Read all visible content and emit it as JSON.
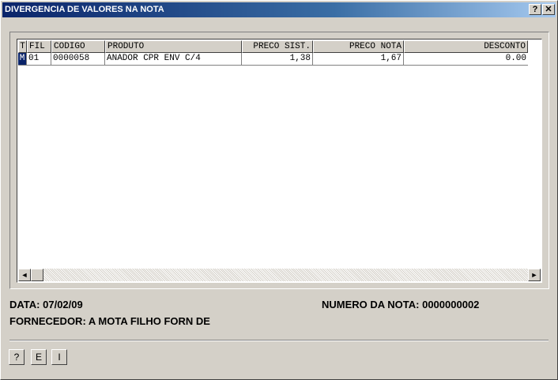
{
  "window": {
    "title": "DIVERGENCIA DE VALORES NA NOTA",
    "help_btn": "?",
    "close_btn": "✕"
  },
  "grid": {
    "columns": [
      "T",
      "FIL",
      "CODIGO",
      "PRODUTO",
      "PRECO SIST.",
      "PRECO NOTA",
      "DESCONTO"
    ],
    "rows": [
      {
        "t": "M",
        "fil": "01",
        "codigo": "0000058",
        "produto": "ANADOR CPR ENV C/4",
        "preco_sist": "1,38",
        "preco_nota": "1,67",
        "desconto": "0.00"
      }
    ],
    "scroll_left": "◄",
    "scroll_right": "►"
  },
  "info": {
    "data": "DATA: 07/02/09",
    "numero_nota": "NUMERO DA NOTA: 0000000002",
    "fornecedor": "FORNECEDOR: A MOTA FILHO FORN DE"
  },
  "buttons": {
    "help": "?",
    "e": "E",
    "i": "I"
  }
}
